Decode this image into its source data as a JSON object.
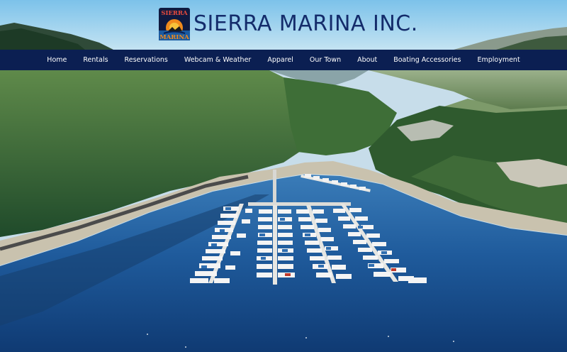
{
  "brand": {
    "title": "SIERRA MARINA INC.",
    "logo_top": "SIERRA",
    "logo_bottom": "MARINA"
  },
  "nav": {
    "items": [
      {
        "label": "Home",
        "name": "nav-home"
      },
      {
        "label": "Rentals",
        "name": "nav-rentals"
      },
      {
        "label": "Reservations",
        "name": "nav-reservations"
      },
      {
        "label": "Webcam & Weather",
        "name": "nav-webcam-weather"
      },
      {
        "label": "Apparel",
        "name": "nav-apparel"
      },
      {
        "label": "Our Town",
        "name": "nav-our-town"
      },
      {
        "label": "About",
        "name": "nav-about"
      },
      {
        "label": "Boating Accessories",
        "name": "nav-boating-accessories"
      },
      {
        "label": "Employment",
        "name": "nav-employment"
      }
    ]
  },
  "colors": {
    "nav_bg": "#0b1f52",
    "title": "#142c6b",
    "sky": "#8ec7e4",
    "lake": "#1d4f8c"
  },
  "hero": {
    "description_icon": "aerial-marina-photo"
  }
}
